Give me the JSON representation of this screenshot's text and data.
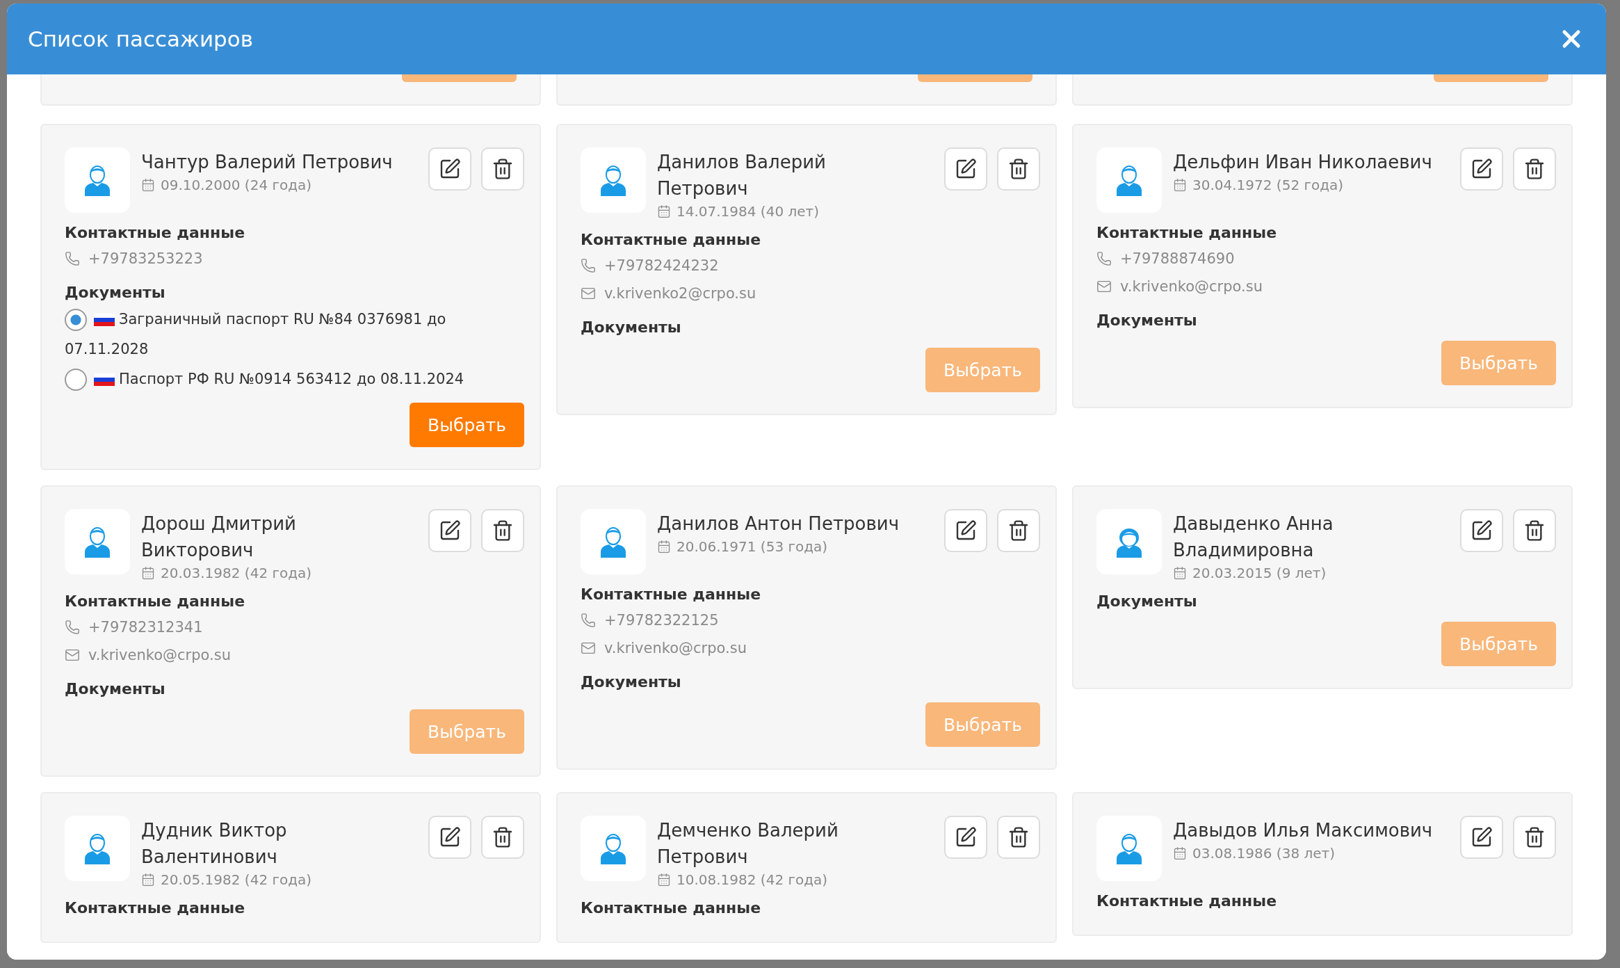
{
  "modal": {
    "title": "Список пассажиров"
  },
  "partial_row": [
    {
      "select_disabled": true
    },
    {
      "select_disabled": true
    },
    {
      "select_disabled": true
    }
  ],
  "passengers": [
    {
      "kind": "male",
      "name": "Чантур Валерий Петрович",
      "birth": "09.10.2000 (24 года)",
      "contacts_heading": "Контактные данные",
      "contacts": [
        {
          "kind": "phone",
          "text": "+79783253223"
        }
      ],
      "documents_heading": "Документы",
      "documents": [
        {
          "selected": true,
          "text": "Заграничный паспорт RU №84 0376981 до 07.11.2028"
        },
        {
          "selected": false,
          "text": "Паспорт РФ RU №0914 563412 до 08.11.2024"
        }
      ],
      "select": {
        "label": "Выбрать",
        "disabled": false
      }
    },
    {
      "kind": "male",
      "name": "Данилов Валерий Петрович",
      "birth": "14.07.1984 (40 лет)",
      "contacts_heading": "Контактные данные",
      "contacts": [
        {
          "kind": "phone",
          "text": "+79782424232"
        },
        {
          "kind": "email",
          "text": "v.krivenko2@crpo.su"
        }
      ],
      "documents_heading": "Документы",
      "select": {
        "label": "Выбрать",
        "disabled": true
      }
    },
    {
      "kind": "male",
      "name": "Дельфин Иван Николаевич",
      "birth": "30.04.1972 (52 года)",
      "contacts_heading": "Контактные данные",
      "contacts": [
        {
          "kind": "phone",
          "text": "+79788874690"
        },
        {
          "kind": "email",
          "text": "v.krivenko@crpo.su"
        }
      ],
      "documents_heading": "Документы",
      "select": {
        "label": "Выбрать",
        "disabled": true
      }
    },
    {
      "kind": "male",
      "name": "Дорош Дмитрий Викторович",
      "birth": "20.03.1982 (42 года)",
      "contacts_heading": "Контактные данные",
      "contacts": [
        {
          "kind": "phone",
          "text": "+79782312341"
        },
        {
          "kind": "email",
          "text": "v.krivenko@crpo.su"
        }
      ],
      "documents_heading": "Документы",
      "select": {
        "label": "Выбрать",
        "disabled": true
      }
    },
    {
      "kind": "male",
      "name": "Данилов Антон Петрович",
      "birth": "20.06.1971 (53 года)",
      "contacts_heading": "Контактные данные",
      "contacts": [
        {
          "kind": "phone",
          "text": "+79782322125"
        },
        {
          "kind": "email",
          "text": "v.krivenko@crpo.su"
        }
      ],
      "documents_heading": "Документы",
      "select": {
        "label": "Выбрать",
        "disabled": true
      }
    },
    {
      "kind": "female",
      "name": "Давыденко Анна Владимировна",
      "birth": "20.03.2015 (9 лет)",
      "documents_heading": "Документы",
      "select": {
        "label": "Выбрать",
        "disabled": true
      }
    },
    {
      "kind": "male",
      "name": "Дудник Виктор Валентинович",
      "birth": "20.05.1982 (42 года)",
      "contacts_heading": "Контактные данные"
    },
    {
      "kind": "male",
      "name": "Демченко Валерий Петрович",
      "birth": "10.08.1982 (42 года)",
      "contacts_heading": "Контактные данные"
    },
    {
      "kind": "male",
      "name": "Давыдов Илья Максимович",
      "birth": "03.08.1986 (38 лет)",
      "contacts_heading": "Контактные данные"
    }
  ]
}
